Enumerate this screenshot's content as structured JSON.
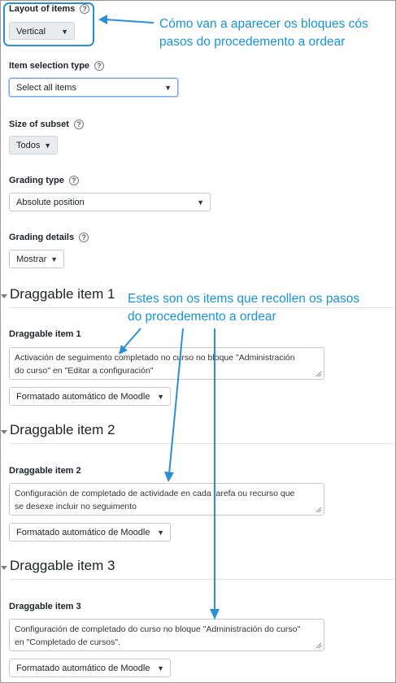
{
  "layout_section": {
    "label": "Layout of items",
    "value": "Vertical"
  },
  "selection_type": {
    "label": "Item selection type",
    "value": "Select all items"
  },
  "subset": {
    "label": "Size of subset",
    "value": "Todos"
  },
  "grading_type": {
    "label": "Grading type",
    "value": "Absolute position"
  },
  "grading_details": {
    "label": "Grading details",
    "value": "Mostrar"
  },
  "help_glyph": "?",
  "arrow_glyph": "▼",
  "annotations": {
    "top_line1": "Cómo van a aparecer os bloques cós",
    "top_line2": "pasos do procedemento a ordear",
    "mid_line1": "Estes son os items que recollen os pasos",
    "mid_line2": "do procedemento a ordear",
    "color": "#1893d8"
  },
  "items": [
    {
      "section_title": "Draggable item 1",
      "field_label": "Draggable item 1",
      "text_line1": "Activación de seguimento completado no curso no bloque \"Administración",
      "text_line2": "do curso\" en \"Editar a configuración\"",
      "format": "Formatado automático de Moodle"
    },
    {
      "section_title": "Draggable item 2",
      "field_label": "Draggable item 2",
      "text_line1": "Configuración de completado de actividade en cada tarefa ou recurso que",
      "text_line2": "se desexe incluir no seguimento",
      "format": "Formatado automático de Moodle"
    },
    {
      "section_title": "Draggable item 3",
      "field_label": "Draggable item 3",
      "text_line1": "Configuración de completado do curso no bloque \"Administración do curso\"",
      "text_line2": "en \"Completado de cursos\".",
      "format": "Formatado automático de Moodle"
    }
  ]
}
